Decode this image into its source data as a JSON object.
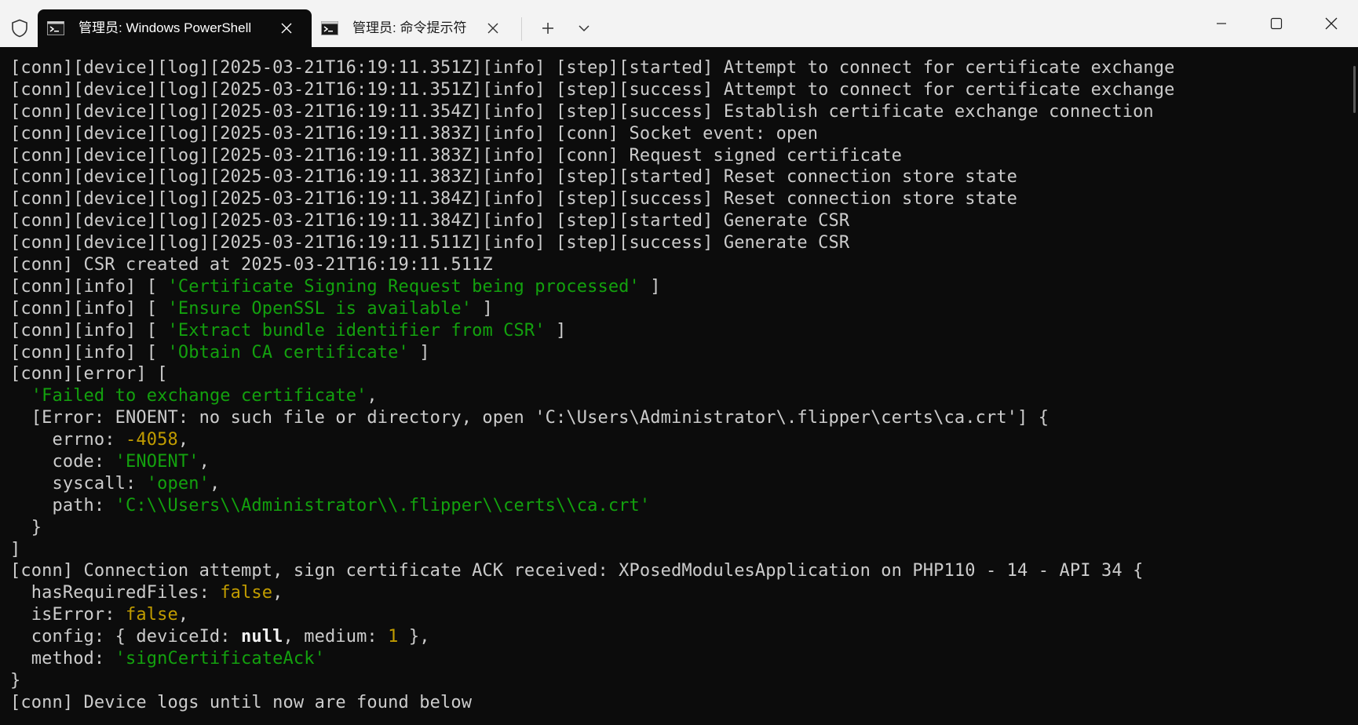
{
  "titlebar": {
    "tabs": [
      {
        "label": "管理员: Windows PowerShell",
        "active": true
      },
      {
        "label": "管理员: 命令提示符",
        "active": false
      }
    ],
    "new_tab_icon": "plus-icon",
    "dropdown_icon": "chevron-down-icon",
    "window_controls": [
      "minimize-icon",
      "maximize-icon",
      "close-icon"
    ]
  },
  "colors": {
    "background": "#0c0c0c",
    "text": "#cccccc",
    "string_green": "#13a10e",
    "number_yellow": "#c19c00",
    "titlebar": "#f3f3f3"
  },
  "terminal": {
    "lines": [
      [
        {
          "t": "[conn][device][log][2025-03-21T16:19:11.351Z][info] [step][started] Attempt to connect for certificate exchange"
        }
      ],
      [
        {
          "t": "[conn][device][log][2025-03-21T16:19:11.351Z][info] [step][success] Attempt to connect for certificate exchange"
        }
      ],
      [
        {
          "t": "[conn][device][log][2025-03-21T16:19:11.354Z][info] [step][success] Establish certificate exchange connection"
        }
      ],
      [
        {
          "t": "[conn][device][log][2025-03-21T16:19:11.383Z][info] [conn] Socket event: open"
        }
      ],
      [
        {
          "t": "[conn][device][log][2025-03-21T16:19:11.383Z][info] [conn] Request signed certificate"
        }
      ],
      [
        {
          "t": "[conn][device][log][2025-03-21T16:19:11.383Z][info] [step][started] Reset connection store state"
        }
      ],
      [
        {
          "t": "[conn][device][log][2025-03-21T16:19:11.384Z][info] [step][success] Reset connection store state"
        }
      ],
      [
        {
          "t": "[conn][device][log][2025-03-21T16:19:11.384Z][info] [step][started] Generate CSR"
        }
      ],
      [
        {
          "t": "[conn][device][log][2025-03-21T16:19:11.511Z][info] [step][success] Generate CSR"
        }
      ],
      [
        {
          "t": "[conn] CSR created at 2025-03-21T16:19:11.511Z"
        }
      ],
      [
        {
          "t": "[conn][info] [ "
        },
        {
          "t": "'Certificate Signing Request being processed'",
          "c": "g"
        },
        {
          "t": " ]"
        }
      ],
      [
        {
          "t": "[conn][info] [ "
        },
        {
          "t": "'Ensure OpenSSL is available'",
          "c": "g"
        },
        {
          "t": " ]"
        }
      ],
      [
        {
          "t": "[conn][info] [ "
        },
        {
          "t": "'Extract bundle identifier from CSR'",
          "c": "g"
        },
        {
          "t": " ]"
        }
      ],
      [
        {
          "t": "[conn][info] [ "
        },
        {
          "t": "'Obtain CA certificate'",
          "c": "g"
        },
        {
          "t": " ]"
        }
      ],
      [
        {
          "t": "[conn][error] ["
        }
      ],
      [
        {
          "t": "  "
        },
        {
          "t": "'Failed to exchange certificate'",
          "c": "g"
        },
        {
          "t": ","
        }
      ],
      [
        {
          "t": "  [Error: ENOENT: no such file or directory, open 'C:\\Users\\Administrator\\.flipper\\certs\\ca.crt'] {"
        }
      ],
      [
        {
          "t": "    errno: "
        },
        {
          "t": "-4058",
          "c": "y"
        },
        {
          "t": ","
        }
      ],
      [
        {
          "t": "    code: "
        },
        {
          "t": "'ENOENT'",
          "c": "g"
        },
        {
          "t": ","
        }
      ],
      [
        {
          "t": "    syscall: "
        },
        {
          "t": "'open'",
          "c": "g"
        },
        {
          "t": ","
        }
      ],
      [
        {
          "t": "    path: "
        },
        {
          "t": "'C:\\\\Users\\\\Administrator\\\\.flipper\\\\certs\\\\ca.crt'",
          "c": "g"
        }
      ],
      [
        {
          "t": "  }"
        }
      ],
      [
        {
          "t": "]"
        }
      ],
      [
        {
          "t": "[conn] Connection attempt, sign certificate ACK received: XPosedModulesApplication on PHP110 - 14 - API 34 {"
        }
      ],
      [
        {
          "t": "  hasRequiredFiles: "
        },
        {
          "t": "false",
          "c": "y"
        },
        {
          "t": ","
        }
      ],
      [
        {
          "t": "  isError: "
        },
        {
          "t": "false",
          "c": "y"
        },
        {
          "t": ","
        }
      ],
      [
        {
          "t": "  config: { deviceId: "
        },
        {
          "t": "null",
          "c": "b"
        },
        {
          "t": ", medium: "
        },
        {
          "t": "1",
          "c": "y"
        },
        {
          "t": " },"
        }
      ],
      [
        {
          "t": "  method: "
        },
        {
          "t": "'signCertificateAck'",
          "c": "g"
        }
      ],
      [
        {
          "t": "}"
        }
      ],
      [
        {
          "t": "[conn] Device logs until now are found below"
        }
      ]
    ]
  }
}
